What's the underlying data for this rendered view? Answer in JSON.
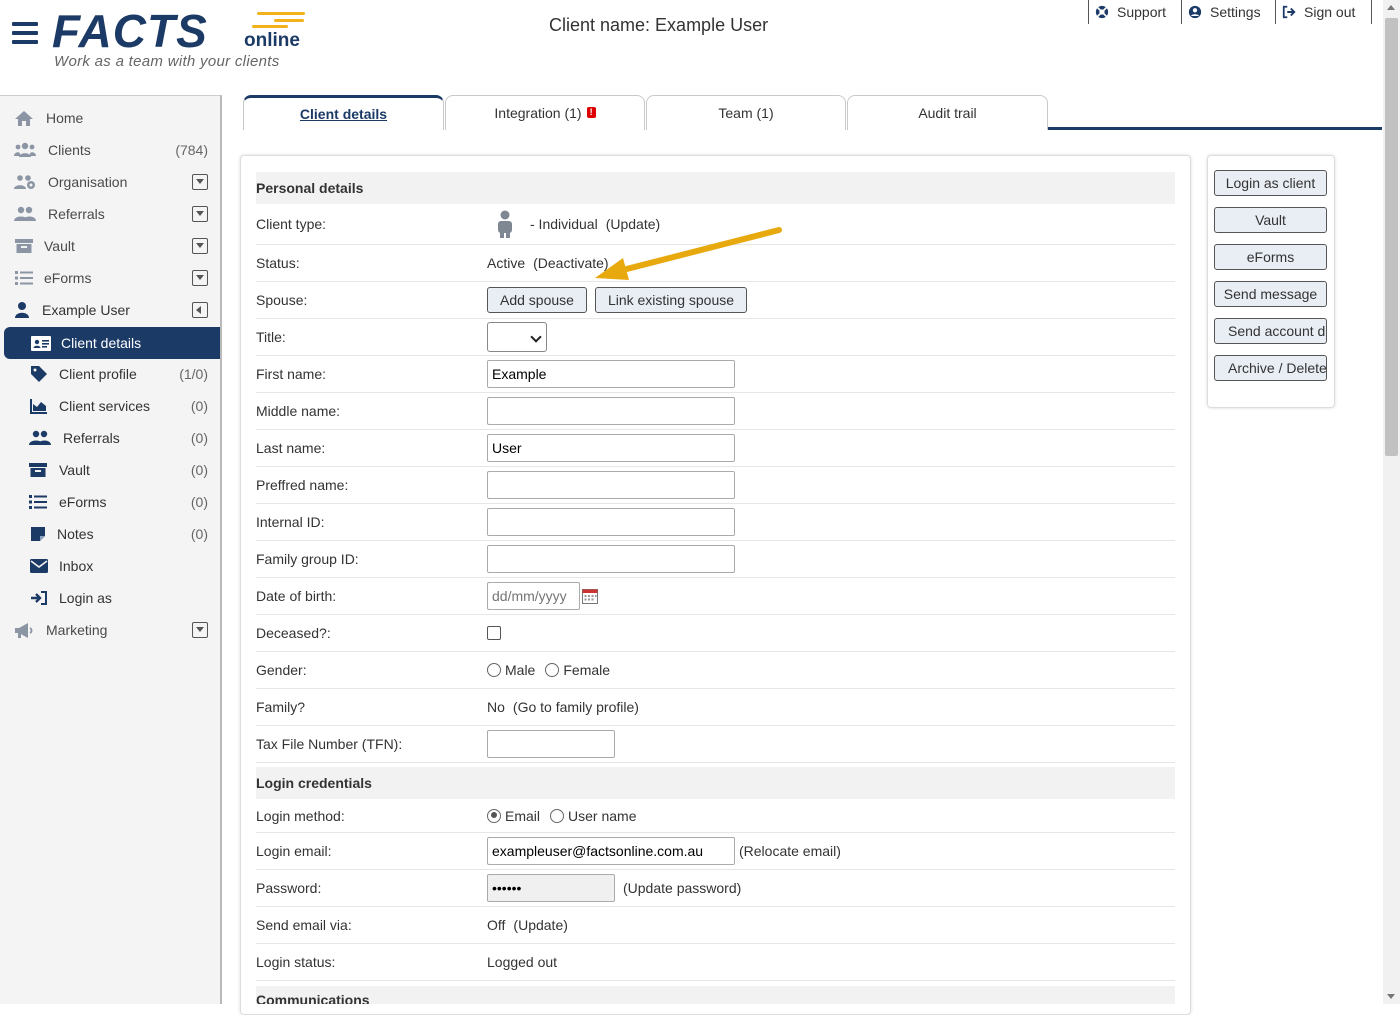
{
  "app": {
    "logo_main": "FACTS",
    "logo_sub": "online",
    "tagline": "Work as a team with your clients",
    "page_title": "Client name: Example User",
    "brand_color": "#1b3a66",
    "accent_color": "#f2b21c"
  },
  "topnav": [
    {
      "label": "Support",
      "icon": "lifebuoy-icon"
    },
    {
      "label": "Settings",
      "icon": "user-circle-icon"
    },
    {
      "label": "Sign out",
      "icon": "sign-out-icon"
    }
  ],
  "sidebar": {
    "items": [
      {
        "label": "Home",
        "icon": "home-icon"
      },
      {
        "label": "Clients",
        "icon": "users-icon",
        "count": "(784)"
      },
      {
        "label": "Organisation",
        "icon": "organisation-icon",
        "dropdown": true
      },
      {
        "label": "Referrals",
        "icon": "referrals-icon",
        "dropdown": true
      },
      {
        "label": "Vault",
        "icon": "archive-icon",
        "dropdown": true
      },
      {
        "label": "eForms",
        "icon": "list-icon",
        "dropdown": true
      },
      {
        "label": "Example User",
        "icon": "user-icon",
        "collapse": true
      },
      {
        "label": "Client details",
        "icon": "id-card-icon",
        "active": true
      },
      {
        "label": "Client profile",
        "icon": "tag-icon",
        "count": "(1/0)"
      },
      {
        "label": "Client services",
        "icon": "chart-icon",
        "count": "(0)"
      },
      {
        "label": "Referrals",
        "icon": "referrals-icon",
        "count": "(0)"
      },
      {
        "label": "Vault",
        "icon": "archive-icon",
        "count": "(0)"
      },
      {
        "label": "eForms",
        "icon": "list-icon",
        "count": "(0)"
      },
      {
        "label": "Notes",
        "icon": "note-icon",
        "count": "(0)"
      },
      {
        "label": "Inbox",
        "icon": "envelope-icon"
      },
      {
        "label": "Login as",
        "icon": "sign-in-icon"
      },
      {
        "label": "Marketing",
        "icon": "megaphone-icon",
        "dropdown": true
      }
    ]
  },
  "tabs": [
    {
      "label": "Client details",
      "active": true
    },
    {
      "label": "Integration (1)",
      "badge": "!"
    },
    {
      "label": "Team (1)"
    },
    {
      "label": "Audit trail"
    }
  ],
  "personal": {
    "heading": "Personal details",
    "client_type_label": "Client type:",
    "client_type_value": "- Individual",
    "client_type_link": "(Update)",
    "status_label": "Status:",
    "status_value": "Active",
    "status_link": "(Deactivate)",
    "spouse_label": "Spouse:",
    "add_spouse": "Add spouse",
    "link_spouse": "Link existing spouse",
    "title_label": "Title:",
    "title_value": "",
    "first_name_label": "First name:",
    "first_name_value": "Example",
    "middle_name_label": "Middle name:",
    "middle_name_value": "",
    "last_name_label": "Last name:",
    "last_name_value": "User",
    "preferred_label": "Preffred name:",
    "preferred_value": "",
    "internal_id_label": "Internal ID:",
    "internal_id_value": "",
    "family_group_label": "Family group ID:",
    "family_group_value": "",
    "dob_label": "Date of birth:",
    "dob_placeholder": "dd/mm/yyyy",
    "deceased_label": "Deceased?:",
    "gender_label": "Gender:",
    "gender_male": "Male",
    "gender_female": "Female",
    "family_label": "Family?",
    "family_value": "No",
    "family_link": "(Go to family profile)",
    "tfn_label": "Tax File Number (TFN):",
    "tfn_value": ""
  },
  "login": {
    "heading": "Login credentials",
    "method_label": "Login method:",
    "method_email": "Email",
    "method_username": "User name",
    "email_label": "Login email:",
    "email_value": "exampleuser@factsonline.com.au",
    "email_link": "(Relocate email)",
    "password_label": "Password:",
    "password_value": "••••••",
    "password_link": "(Update password)",
    "send_via_label": "Send email via:",
    "send_via_value": "Off",
    "send_via_link": "(Update)",
    "status_label": "Login status:",
    "status_value": "Logged out"
  },
  "communications": {
    "heading": "Communications"
  },
  "actions": [
    "Login as client",
    "Vault",
    "eForms",
    "Send message",
    "Send account d",
    "Archive / Delete"
  ]
}
